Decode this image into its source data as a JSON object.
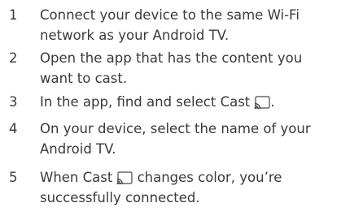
{
  "steps": [
    {
      "number": "1",
      "line1": "Connect your device to the same Wi-Fi",
      "line2": "network as your Android TV."
    },
    {
      "number": "2",
      "line1": "Open the app that has the content you",
      "line2": "want to cast."
    },
    {
      "number": "3",
      "line1_before": "In the app, find and select Cast",
      "line1_after": "."
    },
    {
      "number": "4",
      "line1": "On your device, select the name of your",
      "line2": "Android TV."
    },
    {
      "number": "5",
      "line1_before": "When Cast",
      "line1_after": "changes color, you’re",
      "line2": "successfully connected."
    }
  ],
  "icons": {
    "cast": "cast-icon"
  }
}
